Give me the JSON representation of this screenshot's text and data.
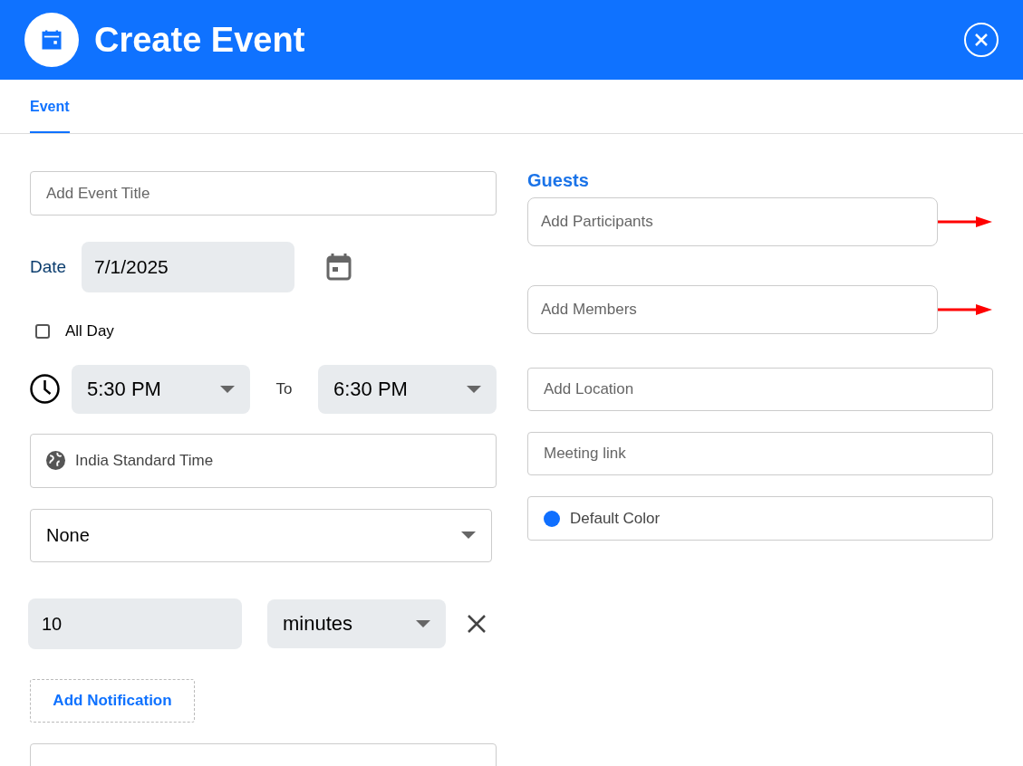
{
  "header": {
    "title": "Create Event"
  },
  "tabs": [
    {
      "label": "Event",
      "selected": true
    }
  ],
  "title_field": {
    "placeholder": "Add Event Title"
  },
  "date": {
    "label": "Date",
    "value": "7/1/2025"
  },
  "all_day": {
    "label": "All Day",
    "checked": false
  },
  "time": {
    "start": "5:30 PM",
    "separator": "To",
    "end": "6:30 PM"
  },
  "timezone": {
    "value": "India Standard Time"
  },
  "repeat": {
    "value": "None"
  },
  "notification": {
    "amount": "10",
    "unit": "minutes"
  },
  "add_notification": {
    "label": "Add Notification"
  },
  "guests": {
    "heading": "Guests",
    "fields": [
      {
        "placeholder": "Add Participants",
        "annotated": true
      },
      {
        "placeholder": "Add Members",
        "annotated": true
      }
    ]
  },
  "location": {
    "placeholder": "Add Location"
  },
  "meeting_link": {
    "placeholder": "Meeting link"
  },
  "color": {
    "label": "Default Color",
    "color": "#0f6fff"
  }
}
